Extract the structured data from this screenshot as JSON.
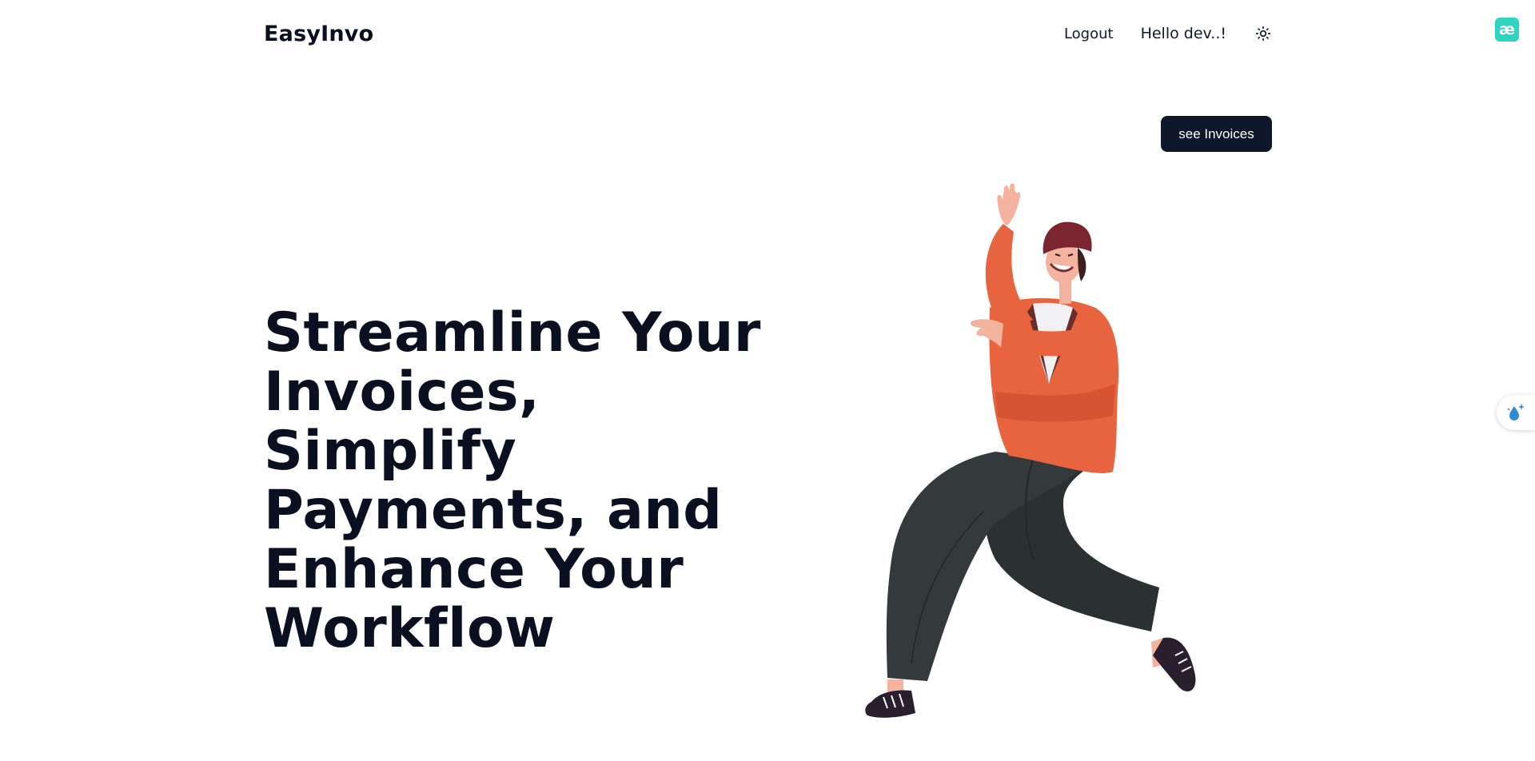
{
  "header": {
    "brand": "EasyInvo",
    "logout_label": "Logout",
    "greeting": "Hello dev..!",
    "theme_icon": "sun-icon"
  },
  "cta": {
    "label": "see Invoices"
  },
  "hero": {
    "title": "Streamline Your Invoices, Simplify Payments, and Enhance Your Workflow",
    "illustration": "dancing-person-illustration"
  },
  "extensions": {
    "top_icon_glyph": "æ",
    "top_icon": "extension-icon",
    "side_icon": "sparkle-drop-icon"
  },
  "colors": {
    "cta_bg": "#0f172a",
    "accent_orange": "#e8643f",
    "pants": "#343a3c",
    "extension_teal": "#2dd4bf"
  }
}
